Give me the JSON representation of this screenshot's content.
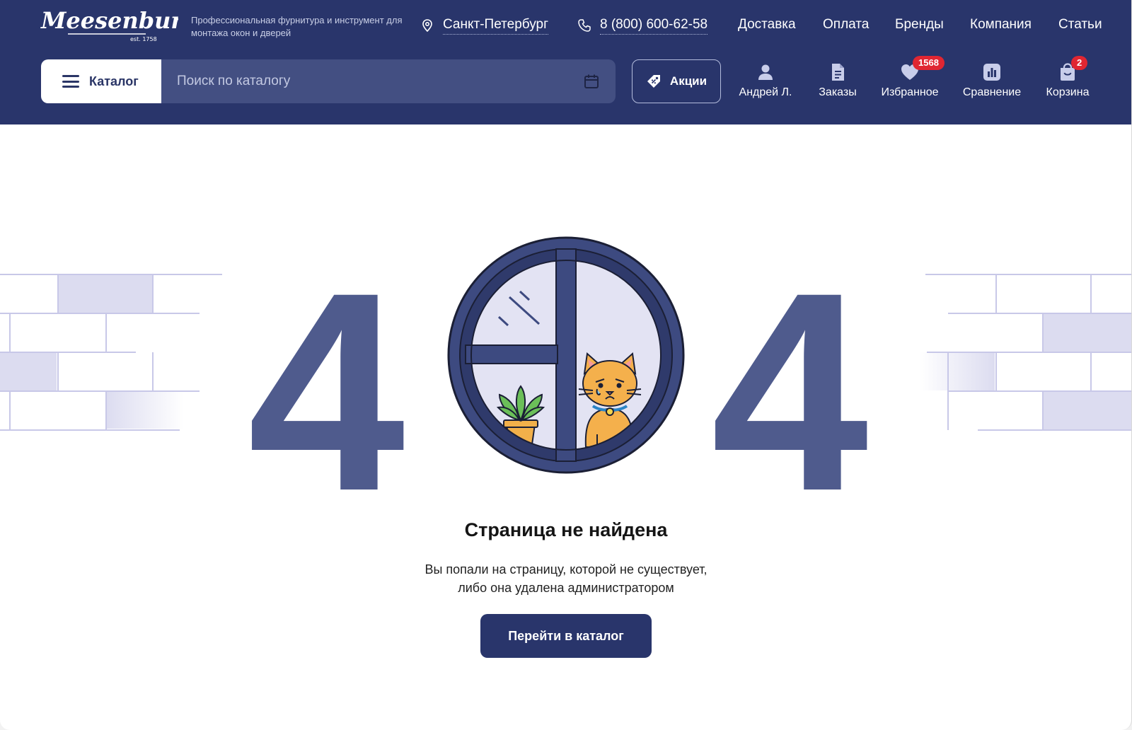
{
  "header": {
    "logo_text": "Meesenburg",
    "logo_est": "est. 1758",
    "tagline": "Профессиональная фурнитура и инструмент для монтажа окон и дверей",
    "city": "Санкт-Петербург",
    "phone": "8 (800) 600-62-58",
    "nav": [
      "Доставка",
      "Оплата",
      "Бренды",
      "Компания",
      "Статьи"
    ],
    "catalog_label": "Каталог",
    "search_placeholder": "Поиск по каталогу",
    "promo_label": "Акции",
    "tools": {
      "account": "Андрей Л.",
      "orders": "Заказы",
      "favorites": "Избранное",
      "favorites_count": "1568",
      "compare": "Сравнение",
      "cart": "Корзина",
      "cart_count": "2"
    }
  },
  "error": {
    "digit_left": "4",
    "digit_right": "4",
    "title": "Страница не найдена",
    "description_line1": "Вы попали на страницу, которой не существует,",
    "description_line2": "либо она удалена администратором",
    "button_label": "Перейти в каталог"
  },
  "icons": {
    "location": "location-pin-icon",
    "phone": "phone-icon",
    "menu": "hamburger-menu-icon",
    "search_calendar": "calendar-icon",
    "promo": "tag-icon",
    "account": "user-icon",
    "orders": "document-icon",
    "favorites": "heart-icon",
    "compare": "bar-chart-icon",
    "cart": "shopping-bag-icon"
  },
  "colors": {
    "header_bg": "#29356b",
    "search_bg": "#434f82",
    "digit": "#4f5b8d",
    "badge": "#e02632",
    "brick": "#dcdcf0"
  }
}
